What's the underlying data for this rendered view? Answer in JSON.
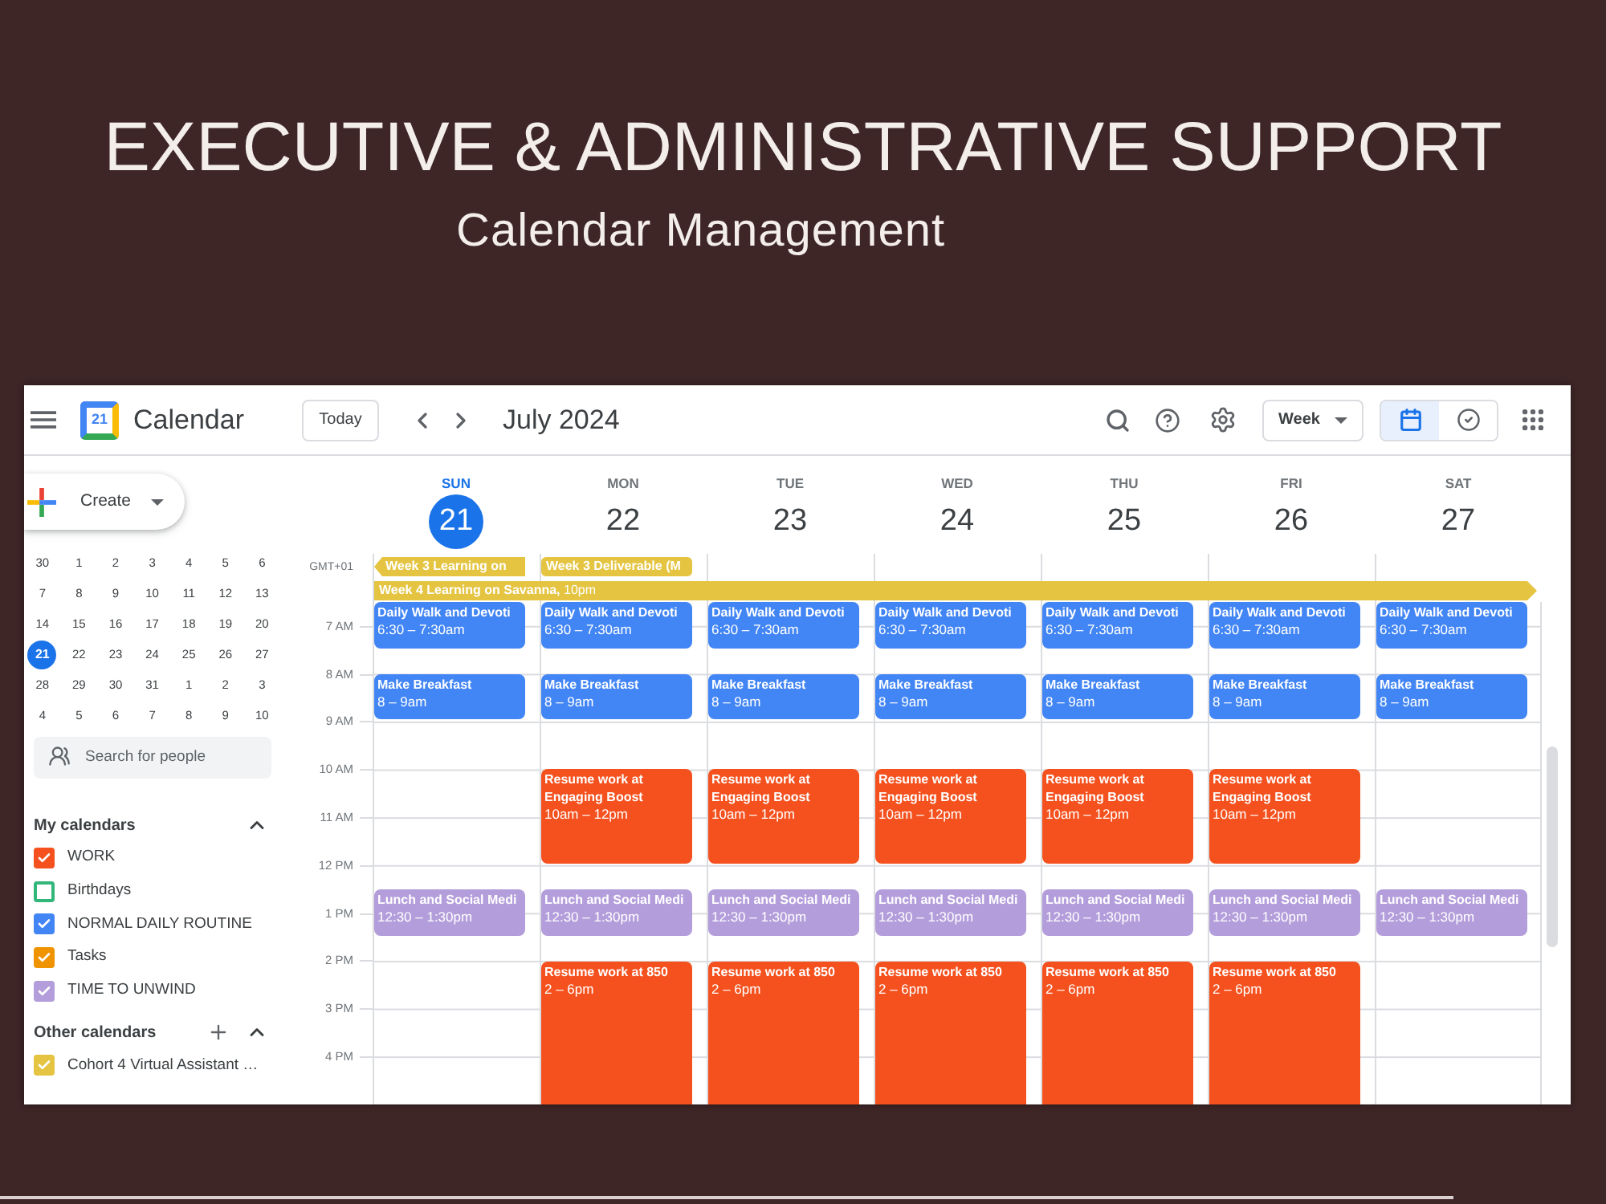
{
  "slide": {
    "title": "EXECUTIVE & ADMINISTRATIVE SUPPORT",
    "subtitle": "Calendar Management"
  },
  "header": {
    "logo_text": "21",
    "app_name": "Calendar",
    "today_button": "Today",
    "period": "July 2024",
    "view_select": "Week",
    "view_toggle": [
      {
        "kind": "calendar",
        "selected": true
      },
      {
        "kind": "tasks",
        "selected": false
      }
    ]
  },
  "sidebar": {
    "create_button": "Create",
    "mini_calendar": [
      [
        {
          "day": "30",
          "selected": false
        },
        {
          "day": "1",
          "selected": false
        },
        {
          "day": "2",
          "selected": false
        },
        {
          "day": "3",
          "selected": false
        },
        {
          "day": "4",
          "selected": false
        },
        {
          "day": "5",
          "selected": false
        },
        {
          "day": "6",
          "selected": false
        }
      ],
      [
        {
          "day": "7",
          "selected": false
        },
        {
          "day": "8",
          "selected": false
        },
        {
          "day": "9",
          "selected": false
        },
        {
          "day": "10",
          "selected": false
        },
        {
          "day": "11",
          "selected": false
        },
        {
          "day": "12",
          "selected": false
        },
        {
          "day": "13",
          "selected": false
        }
      ],
      [
        {
          "day": "14",
          "selected": false
        },
        {
          "day": "15",
          "selected": false
        },
        {
          "day": "16",
          "selected": false
        },
        {
          "day": "17",
          "selected": false
        },
        {
          "day": "18",
          "selected": false
        },
        {
          "day": "19",
          "selected": false
        },
        {
          "day": "20",
          "selected": false
        }
      ],
      [
        {
          "day": "21",
          "selected": true
        },
        {
          "day": "22",
          "selected": false
        },
        {
          "day": "23",
          "selected": false
        },
        {
          "day": "24",
          "selected": false
        },
        {
          "day": "25",
          "selected": false
        },
        {
          "day": "26",
          "selected": false
        },
        {
          "day": "27",
          "selected": false
        }
      ],
      [
        {
          "day": "28",
          "selected": false
        },
        {
          "day": "29",
          "selected": false
        },
        {
          "day": "30",
          "selected": false
        },
        {
          "day": "31",
          "selected": false
        },
        {
          "day": "1",
          "selected": false
        },
        {
          "day": "2",
          "selected": false
        },
        {
          "day": "3",
          "selected": false
        }
      ],
      [
        {
          "day": "4",
          "selected": false
        },
        {
          "day": "5",
          "selected": false
        },
        {
          "day": "6",
          "selected": false
        },
        {
          "day": "7",
          "selected": false
        },
        {
          "day": "8",
          "selected": false
        },
        {
          "day": "9",
          "selected": false
        },
        {
          "day": "10",
          "selected": false
        }
      ]
    ],
    "search": {
      "placeholder": "Search for people"
    },
    "my_calendars": {
      "title": "My calendars",
      "expanded": true,
      "items": [
        {
          "name": "WORK",
          "checked": true,
          "color": "#f4511e"
        },
        {
          "name": "Birthdays",
          "checked": false,
          "color": "#33b679"
        },
        {
          "name": "NORMAL DAILY ROUTINE",
          "checked": true,
          "color": "#4285f4"
        },
        {
          "name": "Tasks",
          "checked": true,
          "color": "#f09300"
        },
        {
          "name": "TIME TO UNWIND",
          "checked": true,
          "color": "#b39ddb"
        }
      ]
    },
    "other_calendars": {
      "title": "Other calendars",
      "expanded": true,
      "items": [
        {
          "name": "Cohort 4 Virtual Assistant …",
          "checked": true,
          "color": "#e4c441"
        }
      ]
    }
  },
  "week": {
    "timezone": "GMT+01",
    "days": [
      {
        "name": "SUN",
        "date": "21",
        "selected": true,
        "all_day": [
          {
            "title": "Week 3 Learning on",
            "continues_before": true,
            "continues_after": false,
            "color": "#e4c441"
          }
        ],
        "events": [
          {
            "title": "Daily Walk and Devoti",
            "time": "6:30 – 7:30am",
            "color": "#4285f4"
          },
          {
            "title": "Make Breakfast",
            "time": "8 – 9am",
            "color": "#4285f4"
          },
          {
            "title": "Lunch and Social Medi",
            "time": "12:30 – 1:30pm",
            "color": "#b39ddb"
          }
        ]
      },
      {
        "name": "MON",
        "date": "22",
        "selected": false,
        "all_day": [
          {
            "title": "Week 3 Deliverable (M",
            "continues_before": false,
            "continues_after": false,
            "color": "#e4c441"
          }
        ],
        "events": [
          {
            "title": "Daily Walk and Devoti",
            "time": "6:30 – 7:30am",
            "color": "#4285f4"
          },
          {
            "title": "Make Breakfast",
            "time": "8 – 9am",
            "color": "#4285f4"
          },
          {
            "title": "Resume work at Engaging Boost",
            "time": "10am – 12pm",
            "color": "#f4511e"
          },
          {
            "title": "Lunch and Social Medi",
            "time": "12:30 – 1:30pm",
            "color": "#b39ddb"
          },
          {
            "title": "Resume work at 850",
            "time": "2 – 6pm",
            "color": "#f4511e"
          }
        ]
      },
      {
        "name": "TUE",
        "date": "23",
        "selected": false,
        "events": [
          {
            "title": "Daily Walk and Devoti",
            "time": "6:30 – 7:30am",
            "color": "#4285f4"
          },
          {
            "title": "Make Breakfast",
            "time": "8 – 9am",
            "color": "#4285f4"
          },
          {
            "title": "Resume work at Engaging Boost",
            "time": "10am – 12pm",
            "color": "#f4511e"
          },
          {
            "title": "Lunch and Social Medi",
            "time": "12:30 – 1:30pm",
            "color": "#b39ddb"
          },
          {
            "title": "Resume work at 850",
            "time": "2 – 6pm",
            "color": "#f4511e"
          }
        ]
      },
      {
        "name": "WED",
        "date": "24",
        "selected": false,
        "events": [
          {
            "title": "Daily Walk and Devoti",
            "time": "6:30 – 7:30am",
            "color": "#4285f4"
          },
          {
            "title": "Make Breakfast",
            "time": "8 – 9am",
            "color": "#4285f4"
          },
          {
            "title": "Resume work at Engaging Boost",
            "time": "10am – 12pm",
            "color": "#f4511e"
          },
          {
            "title": "Lunch and Social Medi",
            "time": "12:30 – 1:30pm",
            "color": "#b39ddb"
          },
          {
            "title": "Resume work at 850",
            "time": "2 – 6pm",
            "color": "#f4511e"
          }
        ]
      },
      {
        "name": "THU",
        "date": "25",
        "selected": false,
        "events": [
          {
            "title": "Daily Walk and Devoti",
            "time": "6:30 – 7:30am",
            "color": "#4285f4"
          },
          {
            "title": "Make Breakfast",
            "time": "8 – 9am",
            "color": "#4285f4"
          },
          {
            "title": "Resume work at Engaging Boost",
            "time": "10am – 12pm",
            "color": "#f4511e"
          },
          {
            "title": "Lunch and Social Medi",
            "time": "12:30 – 1:30pm",
            "color": "#b39ddb"
          },
          {
            "title": "Resume work at 850",
            "time": "2 – 6pm",
            "color": "#f4511e"
          }
        ]
      },
      {
        "name": "FRI",
        "date": "26",
        "selected": false,
        "events": [
          {
            "title": "Daily Walk and Devoti",
            "time": "6:30 – 7:30am",
            "color": "#4285f4"
          },
          {
            "title": "Make Breakfast",
            "time": "8 – 9am",
            "color": "#4285f4"
          },
          {
            "title": "Resume work at Engaging Boost",
            "time": "10am – 12pm",
            "color": "#f4511e"
          },
          {
            "title": "Lunch and Social Medi",
            "time": "12:30 – 1:30pm",
            "color": "#b39ddb"
          },
          {
            "title": "Resume work at 850",
            "time": "2 – 6pm",
            "color": "#f4511e"
          }
        ]
      },
      {
        "name": "SAT",
        "date": "27",
        "selected": false,
        "events": [
          {
            "title": "Daily Walk and Devoti",
            "time": "6:30 – 7:30am",
            "color": "#4285f4"
          },
          {
            "title": "Make Breakfast",
            "time": "8 – 9am",
            "color": "#4285f4"
          },
          {
            "title": "Lunch and Social Medi",
            "time": "12:30 – 1:30pm",
            "color": "#b39ddb"
          }
        ]
      }
    ],
    "spanning_events": [
      {
        "title": "**Week 4 Learning on Savanna,** 10pm",
        "continues_before": false,
        "continues_after": true,
        "color": "#e4c441"
      }
    ],
    "time_labels": [
      "7 AM",
      "8 AM",
      "9 AM",
      "10 AM",
      "11 AM",
      "12 PM",
      "1 PM",
      "2 PM",
      "3 PM",
      "4 PM"
    ]
  }
}
